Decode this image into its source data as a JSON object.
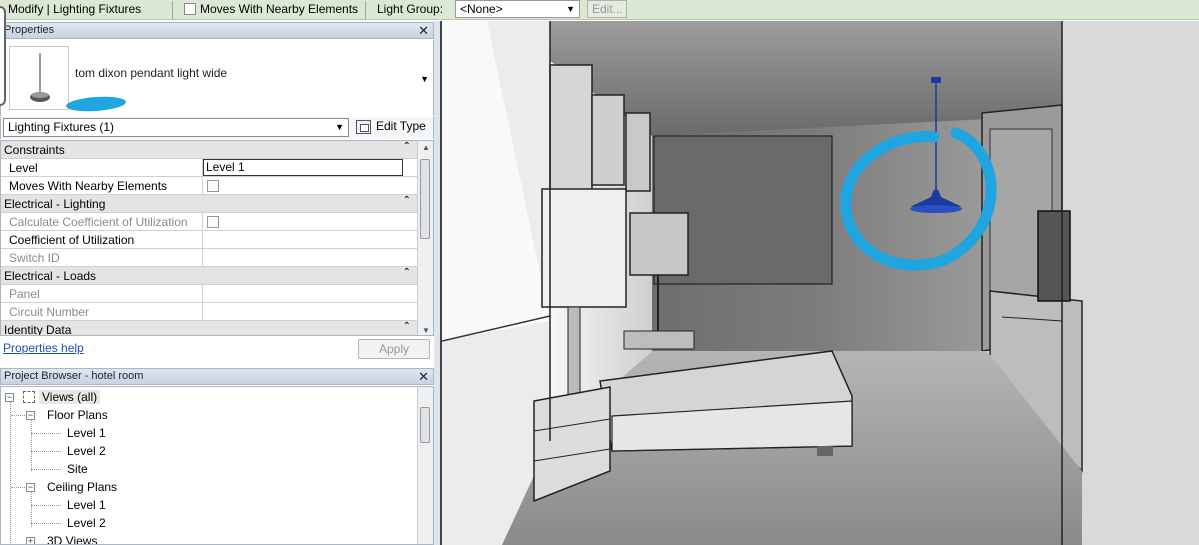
{
  "options_bar": {
    "context_title": "Modify | Lighting Fixtures",
    "moves_label": "Moves With Nearby Elements",
    "light_group_label": "Light Group:",
    "light_group_value": "<None>",
    "edit_label": "Edit..."
  },
  "properties": {
    "title": "Properties",
    "type_name": "tom dixon pendant light wide",
    "filter": "Lighting Fixtures (1)",
    "edit_type": "Edit Type",
    "rows": [
      {
        "label": "Constraints",
        "group": true
      },
      {
        "label": "Level",
        "value": "Level 1"
      },
      {
        "label": "Moves With Nearby Elements"
      },
      {
        "label": "Electrical - Lighting",
        "group": true
      },
      {
        "label": "Calculate Coefficient of Utilization"
      },
      {
        "label": "Coefficient of Utilization"
      },
      {
        "label": "Switch ID"
      },
      {
        "label": "Electrical - Loads",
        "group": true
      },
      {
        "label": "Panel"
      },
      {
        "label": "Circuit Number"
      },
      {
        "label": "Identity Data",
        "group": true
      }
    ],
    "help_link": "Properties help",
    "apply": "Apply"
  },
  "browser": {
    "title": "Project Browser - hotel room",
    "nodes": {
      "views_all": "Views (all)",
      "floor_plans": "Floor Plans",
      "fp_level1": "Level 1",
      "fp_level2": "Level 2",
      "fp_site": "Site",
      "ceiling_plans": "Ceiling Plans",
      "cp_level1": "Level 1",
      "cp_level2": "Level 2",
      "views_3d": "3D Views"
    }
  },
  "colors": {
    "ribbon_bg": "#dbe8d4",
    "highlight_circle": "#1fa5e0",
    "selected_fixture": "#1a3aa0"
  }
}
